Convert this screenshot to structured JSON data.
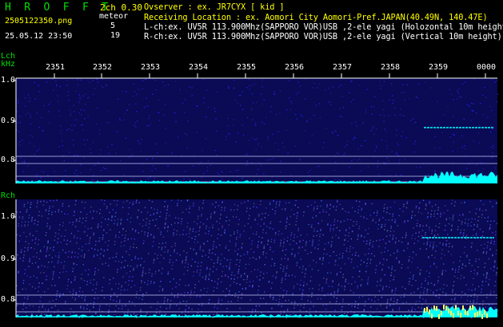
{
  "header": {
    "brand": "H R O F F T",
    "version": "2ch 0.30",
    "filename": "2505122350.png",
    "datetime": "25.05.12  23:50",
    "meteor_label": "meteor",
    "meteor_lch": "5",
    "meteor_rch": "19",
    "observer_line": "Ovserver           : ex. JR7CYX [ kid ]",
    "location_line": "Receiving Location : ex. Aomori City Aomori-Pref.JAPAN(40.49N, 140.47E)",
    "lch_line": "L-ch:ex. UV5R 113.900Mhz(SAPPORO VOR)USB ,2-ele yagi (Holozontal 10m height",
    "rch_line": "R-ch:ex. UV5R 113.900Mhz(SAPPORO VOR)USB ,2-ele yagi (Vertical 10m height)"
  },
  "lch": {
    "label": "Lch",
    "unit": "kHz",
    "y_ticks": [
      "1.0",
      "0.9",
      "0.8"
    ]
  },
  "rch": {
    "label": "Rch",
    "y_ticks": [
      "1.0",
      "0.9",
      "0.8"
    ]
  },
  "time_ticks": [
    "2351",
    "2352",
    "2353",
    "2354",
    "2355",
    "2356",
    "2357",
    "2358",
    "2359",
    "0000"
  ],
  "colors": {
    "text_green": "#00e000",
    "text_yellow": "#ffff00",
    "spectrogram_bg": "#0a0a55",
    "signal": "#00ffff",
    "grid_line": "#c8c8ff"
  }
}
